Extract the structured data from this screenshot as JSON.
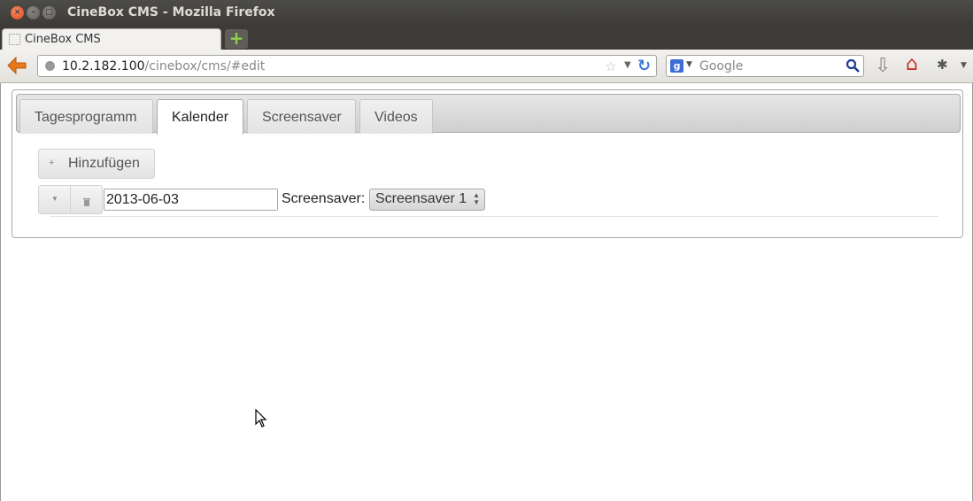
{
  "window": {
    "title": "CineBox CMS - Mozilla Firefox",
    "close_glyph": "×",
    "min_glyph": "–",
    "max_glyph": "□"
  },
  "browser": {
    "tab_title": "CineBox CMS",
    "new_tab_glyph": "+",
    "url_host": "10.2.182.100",
    "url_path": "/cinebox/cms/#edit",
    "search_engine_glyph": "g",
    "search_placeholder": "Google"
  },
  "app": {
    "tabs": [
      {
        "label": "Tagesprogramm",
        "active": false
      },
      {
        "label": "Kalender",
        "active": true
      },
      {
        "label": "Screensaver",
        "active": false
      },
      {
        "label": "Videos",
        "active": false
      }
    ],
    "add_button": {
      "icon_glyph": "+",
      "label": "Hinzufügen"
    },
    "entry": {
      "date_value": "2013-06-03",
      "screensaver_label": "Screensaver:",
      "screensaver_selected": "Screensaver 1"
    }
  },
  "colors": {
    "accent_orange": "#e8781e",
    "titlebar": "#3c3b37",
    "tab_active_bg": "#ffffff"
  }
}
